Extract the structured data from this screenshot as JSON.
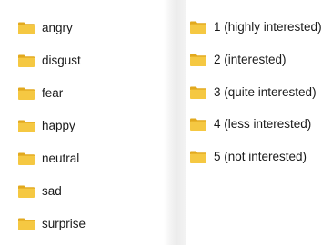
{
  "left_folders": [
    {
      "label": "angry",
      "icon": "folder-icon"
    },
    {
      "label": "disgust",
      "icon": "folder-icon"
    },
    {
      "label": "fear",
      "icon": "folder-icon"
    },
    {
      "label": "happy",
      "icon": "folder-icon"
    },
    {
      "label": "neutral",
      "icon": "folder-icon"
    },
    {
      "label": "sad",
      "icon": "folder-icon"
    },
    {
      "label": "surprise",
      "icon": "folder-icon"
    }
  ],
  "right_folders": [
    {
      "label": "1 (highly interested)",
      "icon": "folder-icon"
    },
    {
      "label": "2 (interested)",
      "icon": "folder-icon"
    },
    {
      "label": "3 (quite interested)",
      "icon": "folder-icon"
    },
    {
      "label": "4 (less interested)",
      "icon": "folder-icon"
    },
    {
      "label": "5 (not interested)",
      "icon": "folder-icon"
    }
  ],
  "colors": {
    "folder_body": "#f5c842",
    "folder_tab": "#e2a91e",
    "text": "#1a1a1a"
  }
}
